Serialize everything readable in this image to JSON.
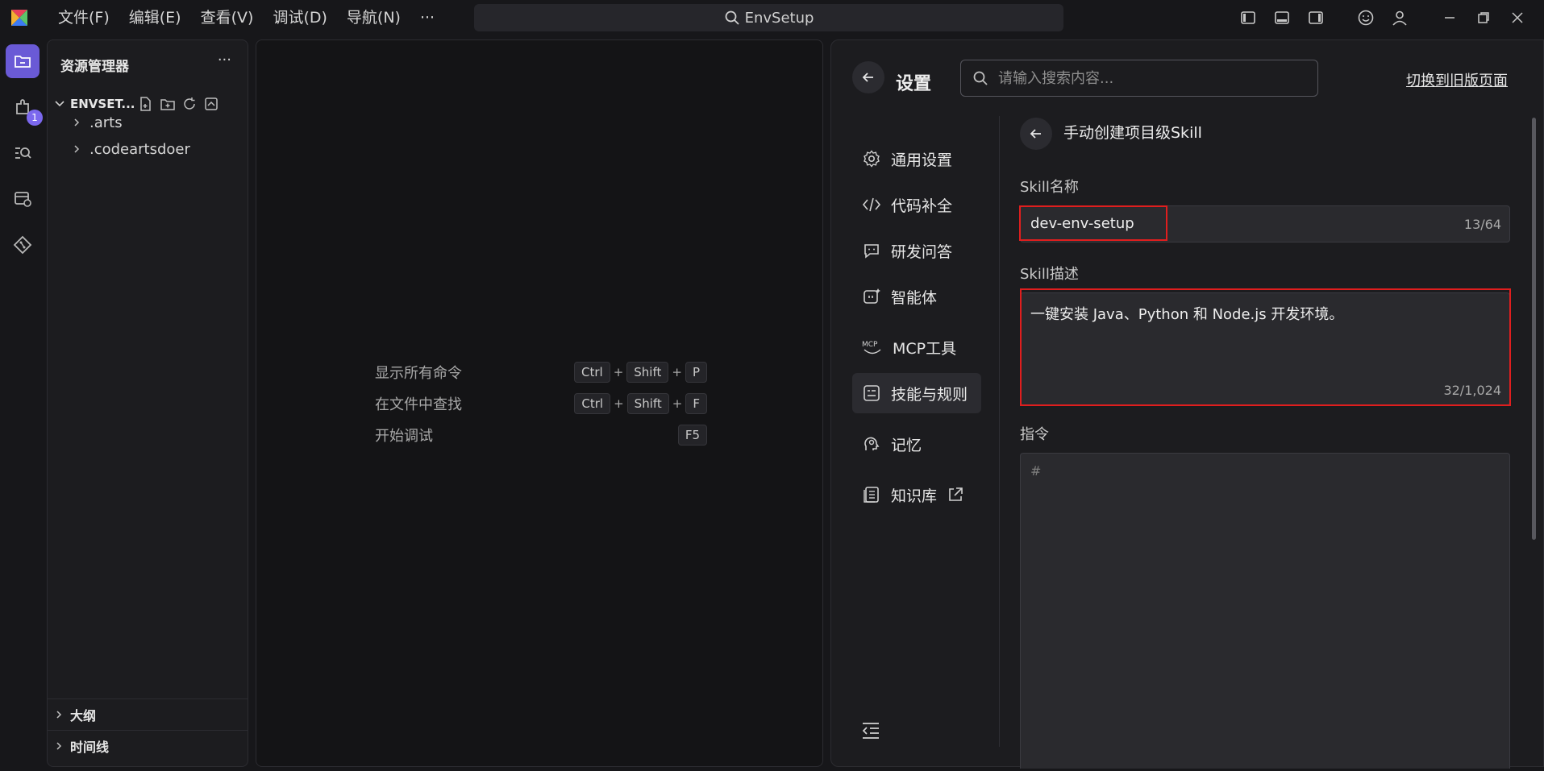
{
  "titlebar": {
    "menus": [
      "文件(F)",
      "编辑(E)",
      "查看(V)",
      "调试(D)",
      "导航(N)",
      "···"
    ],
    "search_text": "EnvSetup"
  },
  "activity": {
    "extensions_badge": "1"
  },
  "explorer": {
    "title": "资源管理器",
    "more": "···",
    "project_name": "ENVSET...",
    "tree": [
      ".arts",
      ".codeartsdoer"
    ],
    "sections": [
      "大纲",
      "时间线"
    ]
  },
  "editor": {
    "shortcuts": [
      {
        "label": "显示所有命令",
        "keys": [
          "Ctrl",
          "Shift",
          "P"
        ]
      },
      {
        "label": "在文件中查找",
        "keys": [
          "Ctrl",
          "Shift",
          "F"
        ]
      },
      {
        "label": "开始调试",
        "keys": [
          "F5"
        ]
      }
    ]
  },
  "settings": {
    "title": "设置",
    "search_placeholder": "请输入搜索内容...",
    "old_page_link": "切换到旧版页面",
    "nav": [
      "通用设置",
      "代码补全",
      "研发问答",
      "智能体",
      "MCP工具",
      "技能与规则",
      "记忆",
      "知识库"
    ],
    "active_nav": "技能与规则",
    "subpage_title": "手动创建项目级Skill",
    "skill_name_label": "Skill名称",
    "skill_name_value": "dev-env-setup",
    "skill_name_counter": "13/64",
    "skill_desc_label": "Skill描述",
    "skill_desc_value": "一键安装 Java、Python 和 Node.js 开发环境。",
    "skill_desc_counter": "32/1,024",
    "instruction_label": "指令",
    "instruction_placeholder": "#"
  },
  "colors": {
    "accent": "#6a5ad6",
    "highlight_box": "#e01e1e"
  }
}
